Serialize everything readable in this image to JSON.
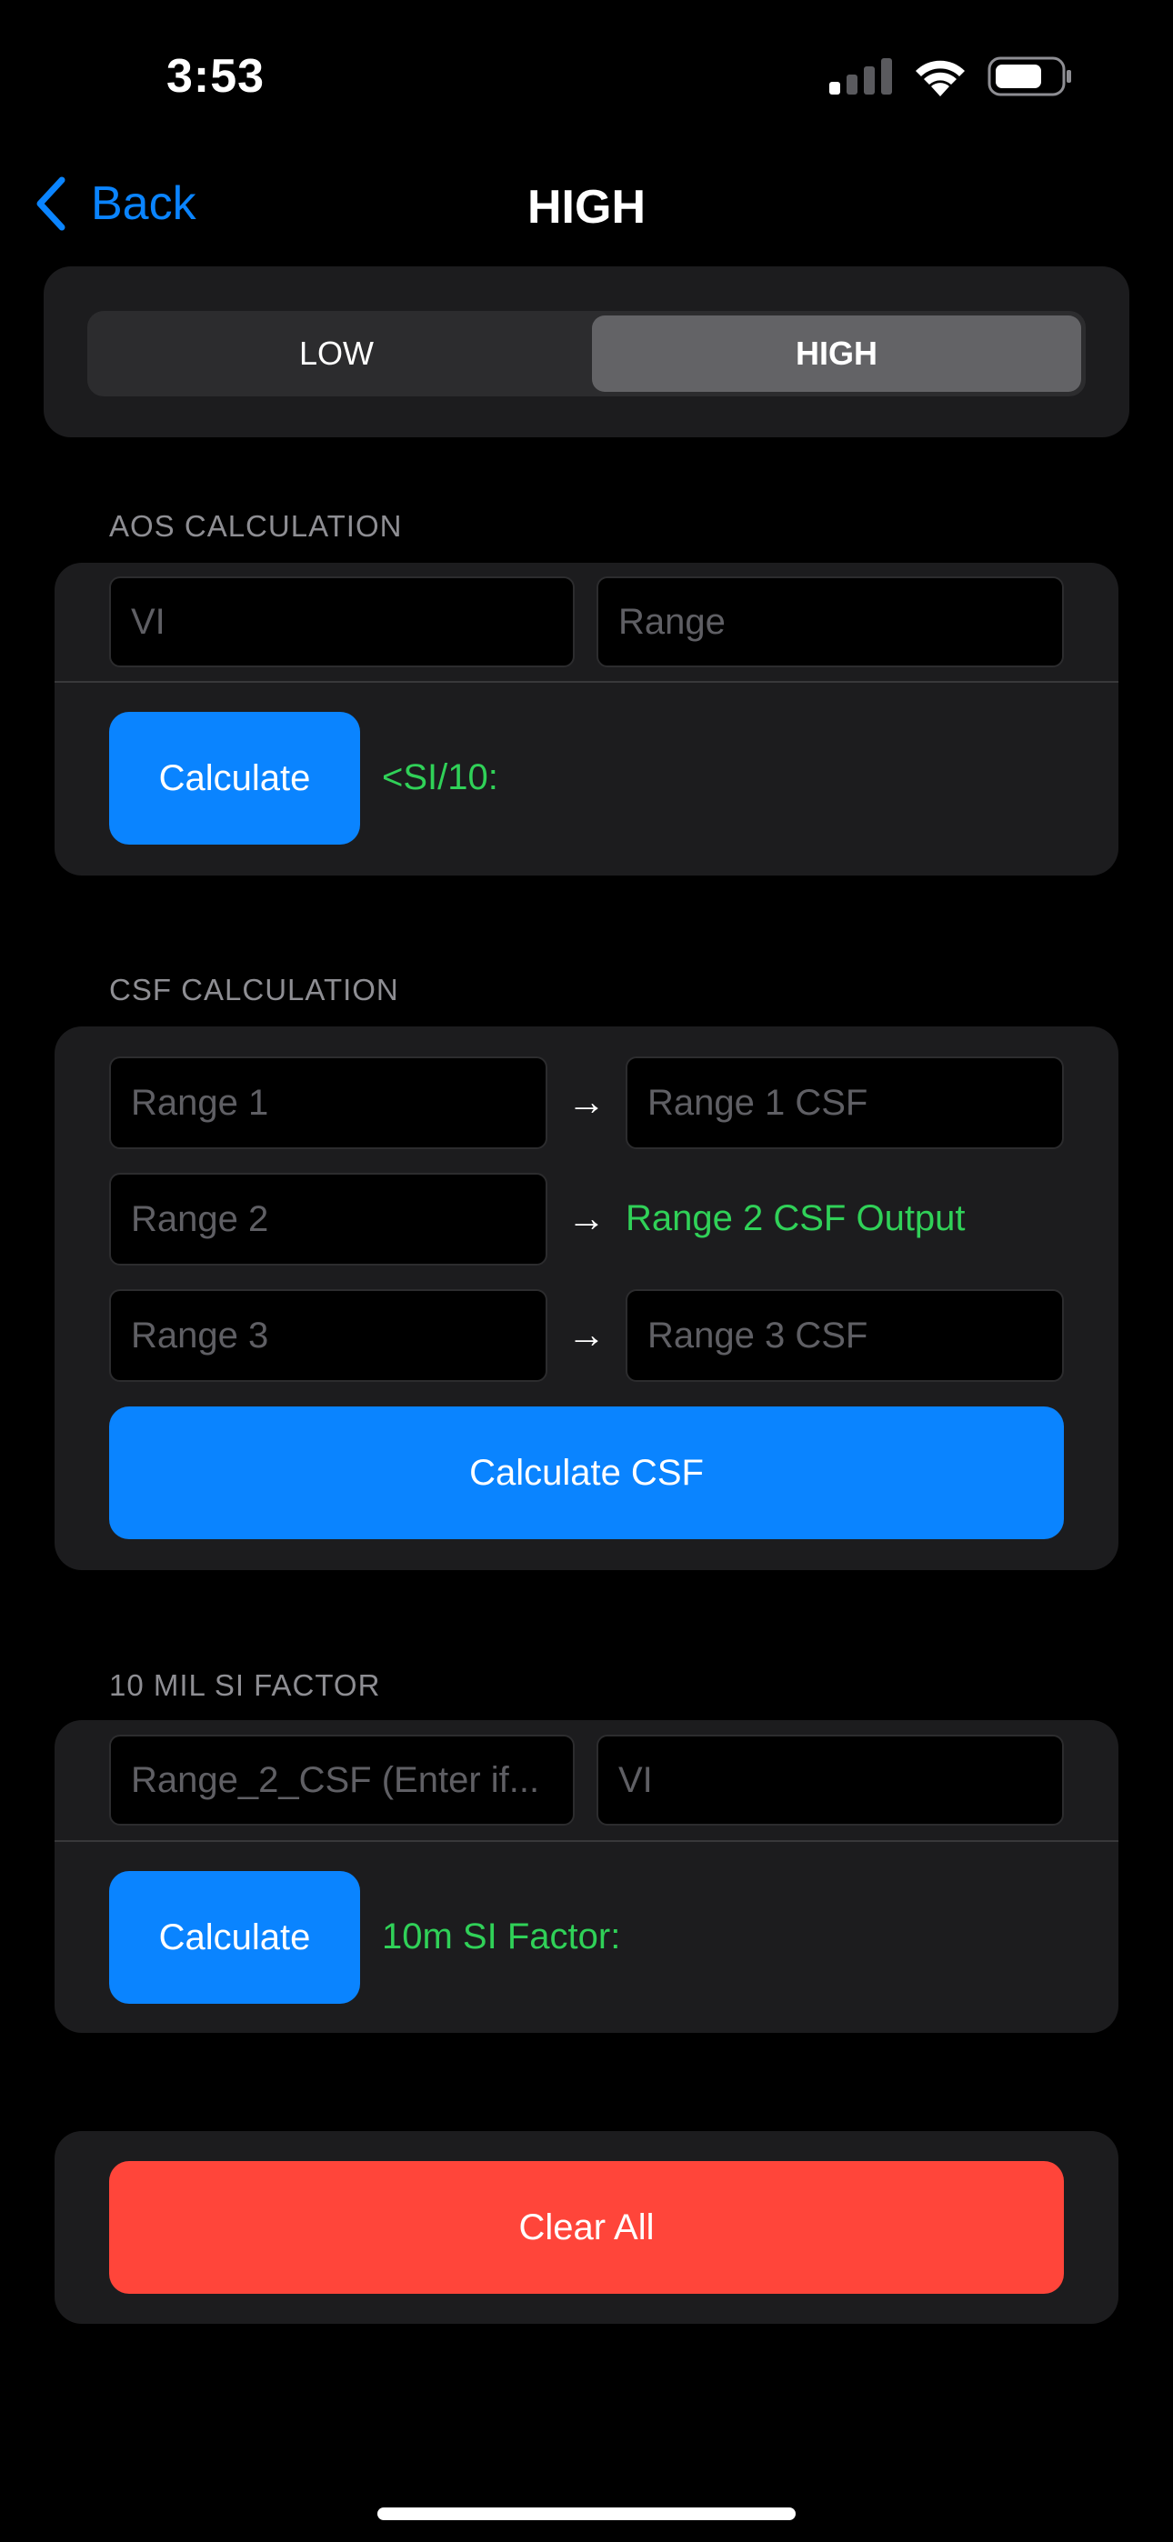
{
  "status_bar": {
    "time": "3:53",
    "icons": [
      "cellular-signal-icon",
      "wifi-icon",
      "battery-icon"
    ]
  },
  "nav": {
    "back_label": "Back",
    "title": "HIGH"
  },
  "segmented": {
    "options": [
      "LOW",
      "HIGH"
    ],
    "selected": "HIGH"
  },
  "aos": {
    "header": "AOS CALCULATION",
    "vi_placeholder": "VI",
    "range_placeholder": "Range",
    "button": "Calculate",
    "result": "<SI/10:"
  },
  "csf": {
    "header": "CSF CALCULATION",
    "rows": [
      {
        "input_placeholder": "Range 1",
        "arrow": "→",
        "output_placeholder": "Range 1 CSF"
      },
      {
        "input_placeholder": "Range 2",
        "arrow": "→",
        "output_text": "Range 2 CSF Output"
      },
      {
        "input_placeholder": "Range 3",
        "arrow": "→",
        "output_placeholder": "Range 3 CSF"
      }
    ],
    "button": "Calculate CSF"
  },
  "si_factor": {
    "header": "10 MIL SI FACTOR",
    "csf_placeholder": "Range_2_CSF (Enter if...",
    "vi_placeholder": "VI",
    "button": "Calculate",
    "result": "10m SI Factor:"
  },
  "clear_all": "Clear All",
  "colors": {
    "accent_blue": "#0a84ff",
    "result_green": "#30d158",
    "destructive_red": "#ff453a",
    "card_bg": "#1c1c1e"
  }
}
